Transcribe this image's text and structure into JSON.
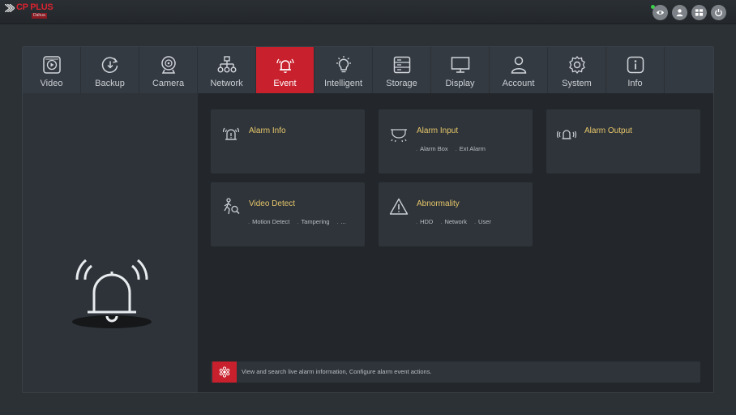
{
  "brand": {
    "logo_text": "CP PLUS",
    "logo_sub": "Dahua"
  },
  "top_buttons": [
    {
      "name": "live-view-button",
      "icon": "eye-icon"
    },
    {
      "name": "user-button",
      "icon": "user-icon"
    },
    {
      "name": "layout-button",
      "icon": "grid-icon"
    },
    {
      "name": "power-button",
      "icon": "power-icon"
    }
  ],
  "nav": {
    "items": [
      {
        "label": "Video",
        "icon": "video-icon"
      },
      {
        "label": "Backup",
        "icon": "backup-icon"
      },
      {
        "label": "Camera",
        "icon": "camera-icon"
      },
      {
        "label": "Network",
        "icon": "network-icon"
      },
      {
        "label": "Event",
        "icon": "alarm-bell-icon",
        "active": true
      },
      {
        "label": "Intelligent",
        "icon": "bulb-icon"
      },
      {
        "label": "Storage",
        "icon": "storage-icon"
      },
      {
        "label": "Display",
        "icon": "monitor-icon"
      },
      {
        "label": "Account",
        "icon": "account-icon"
      },
      {
        "label": "System",
        "icon": "gear-icon"
      },
      {
        "label": "Info",
        "icon": "info-icon"
      }
    ]
  },
  "cards": {
    "alarm_info": {
      "title": "Alarm Info",
      "subs": []
    },
    "alarm_input": {
      "title": "Alarm Input",
      "subs": [
        "Alarm Box",
        "Ext Alarm"
      ]
    },
    "alarm_output": {
      "title": "Alarm Output",
      "subs": []
    },
    "video_detect": {
      "title": "Video Detect",
      "subs": [
        "Motion Detect",
        "Tampering",
        "..."
      ]
    },
    "abnormality": {
      "title": "Abnormality",
      "subs": [
        "HDD",
        "Network",
        "User"
      ]
    }
  },
  "info_bar": {
    "text": "View and search live alarm information, Configure alarm event actions."
  },
  "colors": {
    "accent": "#c8202c",
    "card_title": "#e7c66a",
    "status_online": "#3ad04a"
  }
}
